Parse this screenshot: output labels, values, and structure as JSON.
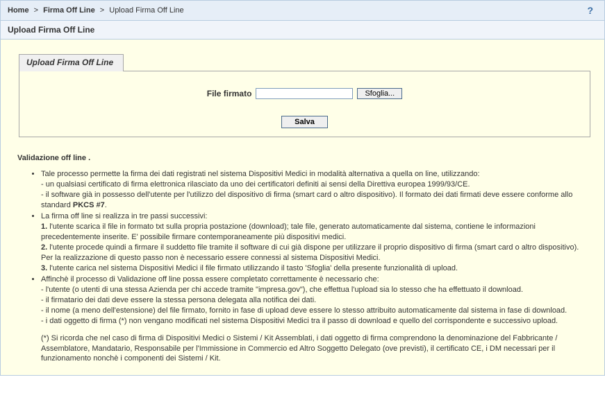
{
  "breadcrumb": {
    "home": "Home",
    "mid": "Firma Off Line",
    "current": "Upload Firma Off Line",
    "sep": ">"
  },
  "help_tooltip": "?",
  "page_title": "Upload Firma Off Line",
  "tab_label": "Upload Firma Off Line",
  "form": {
    "file_label": "File firmato",
    "file_value": "",
    "browse_label": "Sfoglia...",
    "save_label": "Salva"
  },
  "section_heading": "Validazione off line .",
  "bullets": {
    "b1_intro": "Tale processo permette la firma dei dati registrati nel sistema Dispositivi Medici in modalità alternativa a quella on line, utilizzando:",
    "b1_l1": "- un qualsiasi certificato di firma elettronica rilasciato da uno dei certificatori definiti ai sensi della Direttiva europea 1999/93/CE.",
    "b1_l2a": "- il software già in possesso dell'utente per l'utilizzo del dispositivo di firma (smart card o altro dispositivo). Il formato dei dati firmati deve essere conforme allo standard ",
    "b1_l2_bold": "PKCS #7",
    "b1_l2b": ".",
    "b2_intro": "La firma off line si realizza in tre passi successivi:",
    "b2_s1_num": "1.",
    "b2_s1": " l'utente scarica il file in formato txt sulla propria postazione (download); tale file, generato automaticamente dal sistema, contiene le informazioni precedentemente inserite. E' possibile firmare contemporaneamente più dispositivi medici.",
    "b2_s2_num": "2.",
    "b2_s2": " l'utente procede quindi a firmare il suddetto file tramite il software di cui già dispone per utilizzare il proprio dispositivo di firma (smart card o altro dispositivo). Per la realizzazione di questo passo non è necessario essere connessi al sistema Dispositivi Medici.",
    "b2_s3_num": "3.",
    "b2_s3": " l'utente carica nel sistema Dispositivi Medici il file firmato utilizzando il tasto 'Sfoglia' della presente funzionalità di upload.",
    "b3_intro": "Affinchè il processo di Validazione off line possa essere completato correttamente è necessario che:",
    "b3_l1": "- l'utente (o utenti di una stessa Azienda per chi accede tramite \"impresa.gov\"), che effettua l'upload sia lo stesso che ha effettuato il download.",
    "b3_l2": "- il firmatario dei dati deve essere la stessa persona delegata alla notifica dei dati.",
    "b3_l3": "- il nome (a meno dell'estensione) del file firmato, fornito in fase di upload deve essere lo stesso attribuito automaticamente dal sistema in fase di download.",
    "b3_l4": "- i dati oggetto di firma (*) non vengano modificati nel sistema Dispositivi Medici tra il passo di download e quello del corrispondente e successivo upload.",
    "b3_note": "(*) Si ricorda che nel caso di firma di Dispositivi Medici o Sistemi / Kit Assemblati, i dati oggetto di firma comprendono la denominazione del Fabbricante / Assemblatore, Mandatario, Responsabile per l'Immissione in Commercio ed Altro Soggetto Delegato (ove previsti), il certificato CE, i DM necessari per il funzionamento nonchè i componenti dei Sistemi / Kit."
  }
}
